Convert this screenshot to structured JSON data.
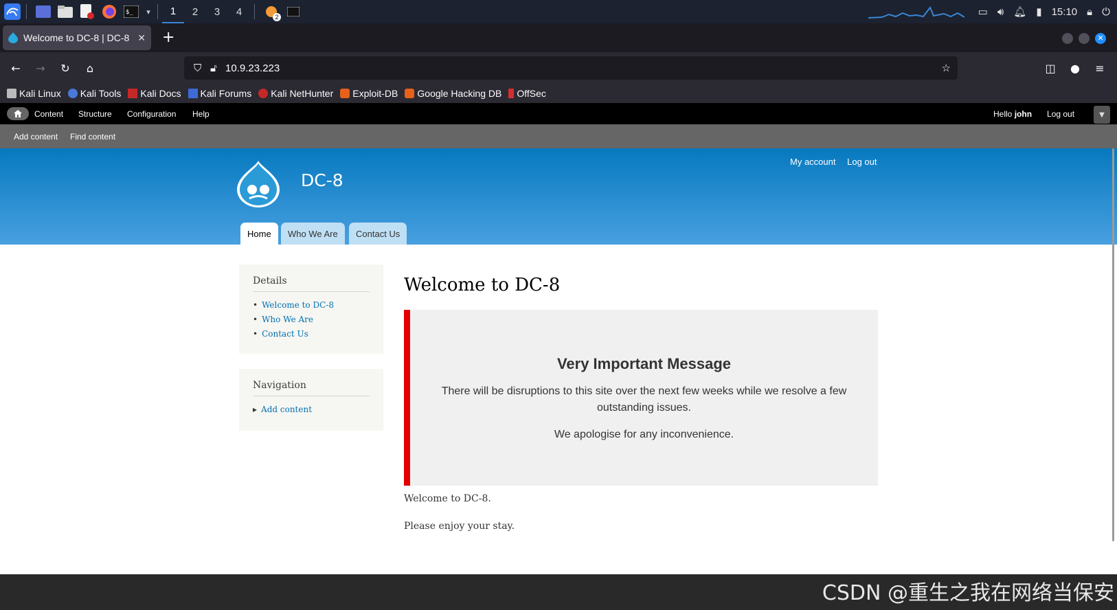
{
  "taskbar": {
    "workspaces": [
      "1",
      "2",
      "3",
      "4"
    ],
    "active_workspace": "1",
    "clock": "15:10",
    "notification_badge": "2"
  },
  "browser": {
    "tab_title": "Welcome to DC-8 | DC-8",
    "url": "10.9.23.223",
    "bookmarks": [
      "Kali Linux",
      "Kali Tools",
      "Kali Docs",
      "Kali Forums",
      "Kali NetHunter",
      "Exploit-DB",
      "Google Hacking DB",
      "OffSec"
    ]
  },
  "admin_toolbar": {
    "menu": [
      "Content",
      "Structure",
      "Configuration",
      "Help"
    ],
    "hello_prefix": "Hello",
    "username": "john",
    "logout": "Log out",
    "shortcuts": [
      "Add content",
      "Find content"
    ]
  },
  "header": {
    "site_name": "DC-8",
    "secondary_menu": [
      "My account",
      "Log out"
    ],
    "main_menu": [
      "Home",
      "Who We Are",
      "Contact Us"
    ]
  },
  "sidebar": {
    "details": {
      "title": "Details",
      "links": [
        "Welcome to DC-8",
        "Who We Are",
        "Contact Us"
      ]
    },
    "navigation": {
      "title": "Navigation",
      "links": [
        "Add content"
      ]
    }
  },
  "content": {
    "title": "Welcome to DC-8",
    "message_heading": "Very Important Message",
    "message_p1": "There will be disruptions to this site over the next few weeks while we resolve a few outstanding issues.",
    "message_p2": "We apologise for any inconvenience.",
    "body_p1": "Welcome to DC-8.",
    "body_p2": "Please enjoy your stay."
  },
  "watermark": "CSDN @重生之我在网络当保安",
  "colors": {
    "header_top": "#0779bf",
    "header_bottom": "#48a0e0",
    "message_border": "#e40000",
    "link": "#0071b3"
  }
}
